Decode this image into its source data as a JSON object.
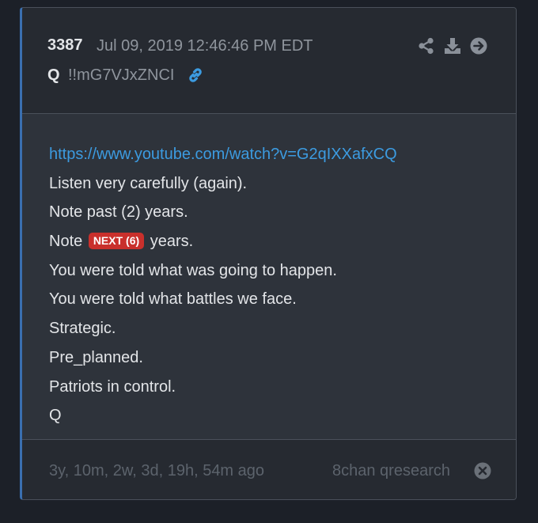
{
  "post": {
    "number": "3387",
    "date": "Jul 09, 2019 12:46:46 PM EDT",
    "author": "Q",
    "tripcode": "!!mG7VJxZNCI"
  },
  "header_icons": {
    "share": "share-icon",
    "download": "download-icon",
    "next": "arrow-circle-right-icon",
    "permalink": "link-icon"
  },
  "body": {
    "url": "https://www.youtube.com/watch?v=G2qIXXafxCQ",
    "lines": [
      "Listen very carefully (again).",
      "Note past (2) years.",
      {
        "before": "Note",
        "badge": "NEXT (6)",
        "after": "years."
      },
      "You were told what was going to happen.",
      "You were told what battles we face.",
      "Strategic.",
      "Pre_planned.",
      "Patriots in control.",
      "Q"
    ]
  },
  "footer": {
    "ago": "3y, 10m, 2w, 3d, 19h, 54m ago",
    "source": "8chan qresearch",
    "close_icon": "close-circle-icon"
  },
  "colors": {
    "page_bg": "#1c2028",
    "card_bg": "#2e333b",
    "header_bg": "#262a31",
    "accent_border": "#3a6fb0",
    "link": "#3c9be0",
    "badge": "#c9302c",
    "text": "#e3e5e8",
    "muted": "#8f959d"
  }
}
